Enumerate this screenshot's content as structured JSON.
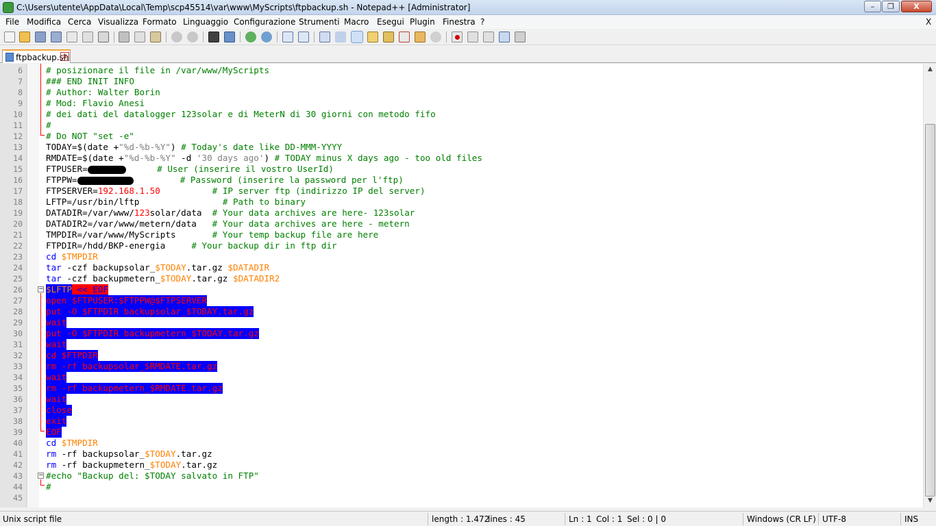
{
  "window": {
    "title": "C:\\Users\\utente\\AppData\\Local\\Temp\\scp45514\\var\\www\\MyScripts\\ftpbackup.sh - Notepad++ [Administrator]",
    "minimize": "–",
    "maximize": "❐",
    "close": "X"
  },
  "menu": [
    "File",
    "Modifica",
    "Cerca",
    "Visualizza",
    "Formato",
    "Linguaggio",
    "Configurazione",
    "Strumenti",
    "Macro",
    "Esegui",
    "Plugin",
    "Finestra",
    "?"
  ],
  "menu_close": "X",
  "tab": {
    "label": "ftpbackup.sh",
    "close": "x"
  },
  "lines": {
    "n6": "6",
    "n7": "7",
    "n8": "8",
    "n9": "9",
    "n10": "10",
    "n11": "11",
    "n12": "12",
    "n13": "13",
    "n14": "14",
    "n15": "15",
    "n16": "16",
    "n17": "17",
    "n18": "18",
    "n19": "19",
    "n20": "20",
    "n21": "21",
    "n22": "22",
    "n23": "23",
    "n24": "24",
    "n25": "25",
    "n26": "26",
    "n27": "27",
    "n28": "28",
    "n29": "29",
    "n30": "30",
    "n31": "31",
    "n32": "32",
    "n33": "33",
    "n34": "34",
    "n35": "35",
    "n36": "36",
    "n37": "37",
    "n38": "38",
    "n39": "39",
    "n40": "40",
    "n41": "41",
    "n42": "42",
    "n43": "43",
    "n44": "44",
    "n45": "45",
    "l6": "# posizionare il file in /var/www/MyScripts",
    "l7": "### END INIT INFO",
    "l8": "# Author: Walter Borin",
    "l9": "# Mod: Flavio Anesi",
    "l10": "# dei dati del datalogger 123solar e di MeterN di 30 giorni con metodo fifo",
    "l11": "#",
    "l12": "# Do NOT \"set -e\"",
    "l13a": "TODAY=$(date +",
    "l13b": "\"%d-%b-%Y\"",
    "l13c": ") ",
    "l13d": "# Today's date like DD-MMM-YYYY",
    "l14a": "RMDATE=$(date +",
    "l14b": "\"%d-%b-%Y\"",
    "l14c": " -d ",
    "l14d": "'30 days ago'",
    "l14e": ") ",
    "l14f": "# TODAY minus X days ago - too old files",
    "l15a": "FTPUSER=",
    "l15c": "# User (inserire il vostro UserId)",
    "l16a": "FTPPW=",
    "l16c": "# Password (inserire la password per l'ftp)",
    "l17a": "FTPSERVER=",
    "l17b": "192.168.1.50",
    "l17c": "# IP server ftp (indirizzo IP del server)",
    "l18a": "LFTP=/usr/bin/lftp",
    "l18c": "# Path to binary",
    "l19a": "DATADIR=/var/www/",
    "l19b": "123",
    "l19c": "solar/data",
    "l19d": "# Your data archives are here- 123solar",
    "l20a": "DATADIR2=/var/www/metern/data",
    "l20c": "# Your data archives are here - metern",
    "l21a": "TMPDIR=/var/www/MyScripts",
    "l21c": "# Your temp backup file are here",
    "l22a": "FTPDIR=/hdd/BKP-energia",
    "l22c": "# Your backup dir in ftp dir",
    "l23a": "cd",
    "l23b": "$TMPDIR",
    "l24a": "tar",
    "l24b": " -czf backupsolar_",
    "l24c": "$TODAY",
    "l24d": ".tar.gz ",
    "l24e": "$DATADIR",
    "l25a": "tar",
    "l25b": " -czf backupmetern_",
    "l25c": "$TODAY",
    "l25d": ".tar.gz ",
    "l25e": "$DATADIR2",
    "l26a": "$LFTP",
    "l26b": " << EOF",
    "l27": "open $FTPUSER:$FTPPW@$FTPSERVER",
    "l28": "put -O $FTPDIR backupsolar_$TODAY.tar.gz",
    "l29": "wait",
    "l30": "put -O $FTPDIR backupmetern_$TODAY.tar.gz",
    "l31": "wait",
    "l32": "cd $FTPDIR",
    "l33": "rm -rf backupsolar_$RMDATE.tar.gz",
    "l34": "wait",
    "l35": "rm -rf backupmetern_$RMDATE.tar.gz",
    "l36": "wait",
    "l37": "close",
    "l38": "exit",
    "l39": "EOF",
    "l40a": "cd",
    "l40b": "$TMPDIR",
    "l41a": "rm",
    "l41b": " -rf backupsolar_",
    "l41c": "$TODAY",
    "l41d": ".tar.gz",
    "l42a": "rm",
    "l42b": " -rf backupmetern_",
    "l42c": "$TODAY",
    "l42d": ".tar.gz",
    "l43": "#echo \"Backup del: $TODAY salvato in FTP\"",
    "l44": "#",
    "l45": ""
  },
  "status": {
    "filetype": "Unix script file",
    "length": "length : 1.472",
    "lines": "lines : 45",
    "ln": "Ln : 1",
    "col": "Col : 1",
    "sel": "Sel : 0 | 0",
    "eol": "Windows (CR LF)",
    "encoding": "UTF-8",
    "mode": "INS"
  },
  "colors": {
    "comment": "#008000",
    "keyword": "#0000ff",
    "variable": "#ff8000",
    "number": "#ff0000",
    "selection": "#0000ff",
    "heredoc": "#ff0000"
  },
  "toolbar_icons": [
    "new-file-icon",
    "open-file-icon",
    "save-icon",
    "save-all-icon",
    "close-icon",
    "close-all-icon",
    "print-icon",
    "cut-icon",
    "copy-icon",
    "paste-icon",
    "undo-icon",
    "redo-icon",
    "find-icon",
    "replace-icon",
    "zoom-in-icon",
    "zoom-out-icon",
    "sync-vertical-icon",
    "sync-horizontal-icon",
    "word-wrap-icon",
    "show-all-chars-icon",
    "indent-guide-icon",
    "lang-udl-icon",
    "doc-map-icon",
    "function-list-icon",
    "folder-workspace-icon",
    "monitor-icon",
    "record-macro-icon",
    "stop-macro-icon",
    "play-macro-icon",
    "run-multiple-macro-icon",
    "save-macro-icon"
  ]
}
